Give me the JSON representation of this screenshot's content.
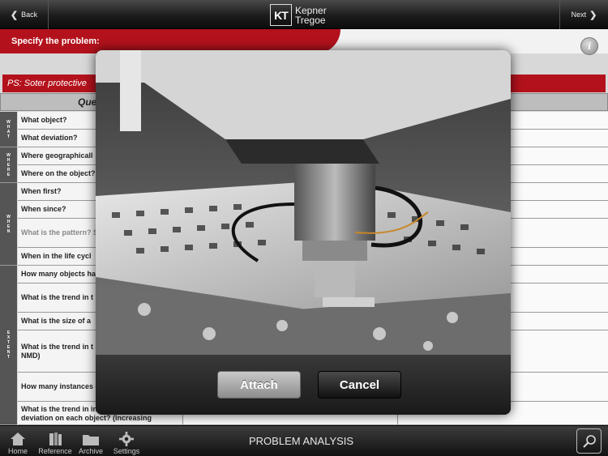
{
  "nav": {
    "back_label": "Back",
    "next_label": "Next",
    "logo_mark": "KT",
    "logo_line1": "Kepner",
    "logo_line2": "Tregoe"
  },
  "specify": {
    "label": "Specify the problem:",
    "info_icon": "i"
  },
  "problem_statement": "PS: Soter protective",
  "columns": {
    "questions": "Quest",
    "is_not": "OT"
  },
  "groups": [
    {
      "label": [
        "W",
        "H",
        "A",
        "T"
      ]
    },
    {
      "label": [
        "W",
        "H",
        "E",
        "R",
        "E"
      ]
    },
    {
      "label": [
        "W",
        "H",
        "E",
        "N"
      ]
    },
    {
      "label": [
        "E",
        "X",
        "T",
        "E",
        "N",
        "T"
      ]
    }
  ],
  "questions": [
    {
      "text": "What object?"
    },
    {
      "text": "What deviation?"
    },
    {
      "text": "Where geographicall"
    },
    {
      "text": "Where on the object?"
    },
    {
      "text": "When first?"
    },
    {
      "text": "When since?"
    },
    {
      "text": "What is the pattern? Sporadic, Single Occ"
    },
    {
      "text": "When in the life cycl"
    },
    {
      "text": "How many objects ha"
    },
    {
      "text": "What is the trend in t (Increasing, decreasi"
    },
    {
      "text": "What is the size of a"
    },
    {
      "text": "What is the trend in t deviation? (Increasin or NMD)"
    },
    {
      "text": "How many instances each object?"
    },
    {
      "text": "What is the trend in instances of the deviation on each object? (Increasing"
    }
  ],
  "modal": {
    "attach_label": "Attach",
    "cancel_label": "Cancel"
  },
  "tabs": [
    {
      "label": "Home"
    },
    {
      "label": "Reference"
    },
    {
      "label": "Archive"
    },
    {
      "label": "Settings"
    }
  ],
  "bottom_title": "PROBLEM ANALYSIS",
  "colors": {
    "brand_red": "#b3121c",
    "bar_dark": "#1c1c1c"
  }
}
